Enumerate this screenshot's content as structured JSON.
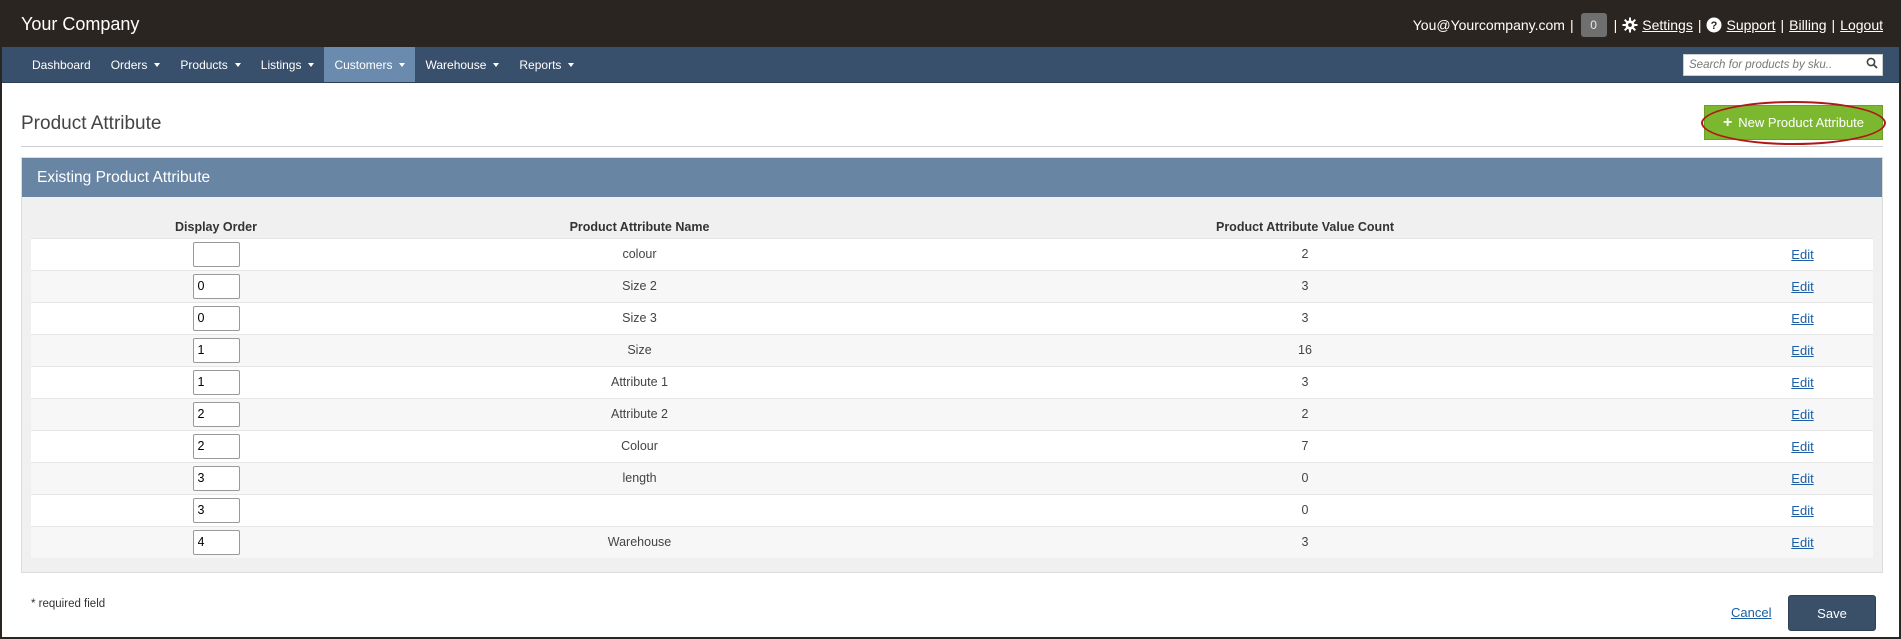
{
  "app": {
    "brand": "Your Company",
    "user_email": "You@Yourcompany.com",
    "notification_count": "0",
    "settings_label": "Settings",
    "support_label": "Support",
    "billing_label": "Billing",
    "logout_label": "Logout",
    "separator": "|"
  },
  "nav": {
    "items": [
      {
        "label": "Dashboard",
        "has_caret": false
      },
      {
        "label": "Orders",
        "has_caret": true
      },
      {
        "label": "Products",
        "has_caret": true
      },
      {
        "label": "Listings",
        "has_caret": true
      },
      {
        "label": "Customers",
        "has_caret": true,
        "active": true
      },
      {
        "label": "Warehouse",
        "has_caret": true
      },
      {
        "label": "Reports",
        "has_caret": true
      }
    ],
    "search_placeholder": "Search for products by sku.."
  },
  "page": {
    "title": "Product Attribute",
    "new_button_label": "New Product Attribute"
  },
  "panel": {
    "title": "Existing Product Attribute",
    "columns": [
      "Display Order",
      "Product Attribute Name",
      "Product Attribute Value Count",
      ""
    ],
    "rows": [
      {
        "order": "",
        "name": "colour",
        "count": "2",
        "edit": "Edit"
      },
      {
        "order": "0",
        "name": "Size 2",
        "count": "3",
        "edit": "Edit"
      },
      {
        "order": "0",
        "name": "Size 3",
        "count": "3",
        "edit": "Edit"
      },
      {
        "order": "1",
        "name": "Size",
        "count": "16",
        "edit": "Edit"
      },
      {
        "order": "1",
        "name": "Attribute 1",
        "count": "3",
        "edit": "Edit"
      },
      {
        "order": "2",
        "name": "Attribute 2",
        "count": "2",
        "edit": "Edit"
      },
      {
        "order": "2",
        "name": "Colour",
        "count": "7",
        "edit": "Edit"
      },
      {
        "order": "3",
        "name": "length",
        "count": "0",
        "edit": "Edit"
      },
      {
        "order": "3",
        "name": "",
        "count": "0",
        "edit": "Edit"
      },
      {
        "order": "4",
        "name": "Warehouse",
        "count": "3",
        "edit": "Edit"
      }
    ]
  },
  "footer": {
    "required_note": "* required field",
    "cancel_label": "Cancel",
    "save_label": "Save"
  },
  "colors": {
    "topbar": "#2b2521",
    "navbar": "#39506c",
    "nav_active": "#6a8bae",
    "panel_header": "#6885a4",
    "new_button": "#7cb82f",
    "save_button": "#3a5068",
    "link": "#1c5fa5",
    "highlight_ring": "#b01818"
  }
}
